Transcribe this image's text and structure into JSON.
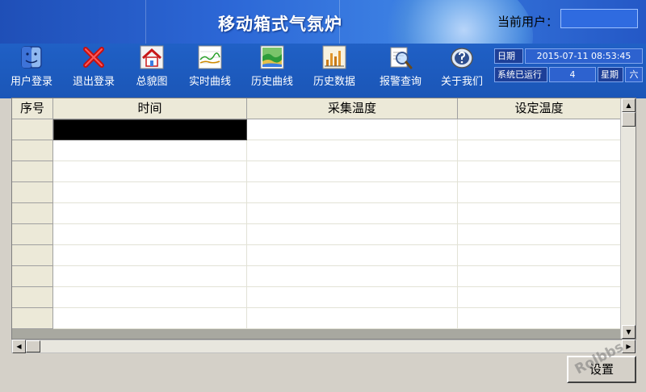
{
  "app": {
    "title": "移动箱式气氛炉"
  },
  "user": {
    "label": "当前用户：",
    "value": ""
  },
  "toolbar": [
    {
      "label": "用户登录",
      "icon": "finder-face-icon"
    },
    {
      "label": "退出登录",
      "icon": "red-x-icon"
    },
    {
      "label": "总貌图",
      "icon": "home-icon"
    },
    {
      "label": "实时曲线",
      "icon": "realtime-curve-icon"
    },
    {
      "label": "历史曲线",
      "icon": "history-curve-icon"
    },
    {
      "label": "历史数据",
      "icon": "history-data-icon"
    },
    {
      "label": "报警查询",
      "icon": "alarm-query-icon"
    },
    {
      "label": "关于我们",
      "icon": "about-icon"
    }
  ],
  "status": {
    "date_label": "日期",
    "datetime": "2015-07-11 08:53:45",
    "runtime_label": "系统已运行",
    "runtime_value": "4",
    "weekday_label": "星期",
    "weekday_value": "六"
  },
  "table": {
    "columns": [
      "序号",
      "时间",
      "采集温度",
      "设定温度"
    ],
    "rows": [
      [
        "",
        "",
        "",
        ""
      ],
      [
        "",
        "",
        "",
        ""
      ],
      [
        "",
        "",
        "",
        ""
      ],
      [
        "",
        "",
        "",
        ""
      ],
      [
        "",
        "",
        "",
        ""
      ],
      [
        "",
        "",
        "",
        ""
      ],
      [
        "",
        "",
        "",
        ""
      ],
      [
        "",
        "",
        "",
        ""
      ],
      [
        "",
        "",
        "",
        ""
      ],
      [
        "",
        "",
        "",
        ""
      ]
    ]
  },
  "buttons": {
    "settings": "设置"
  },
  "watermark": "Rolbbs"
}
